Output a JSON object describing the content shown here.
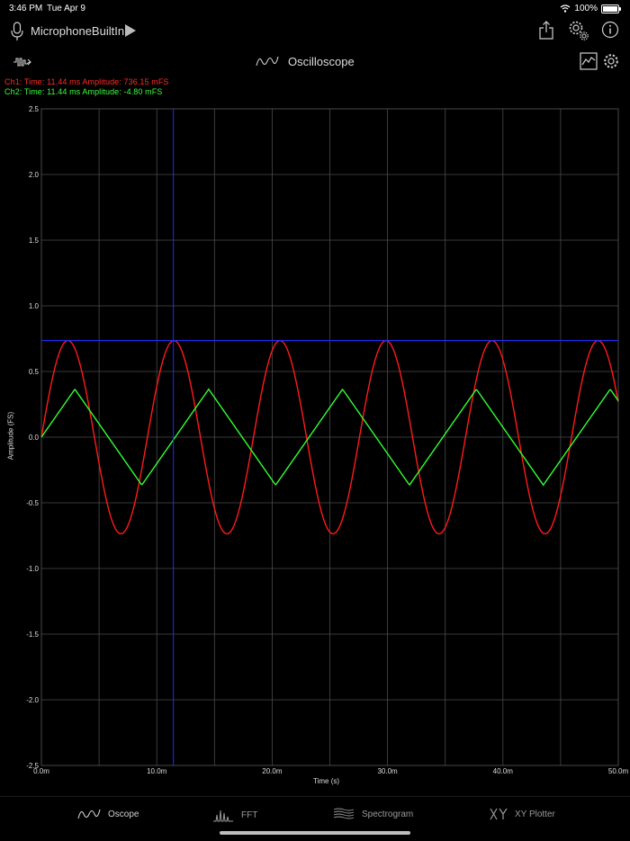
{
  "status_bar": {
    "time": "3:46 PM",
    "date": "Tue Apr 9",
    "battery": "100%",
    "battery_level": 1.0
  },
  "toolbar": {
    "input_source": "MicrophoneBuiltIn"
  },
  "header": {
    "title": "Oscilloscope"
  },
  "readouts": {
    "ch1": "Ch1:  Time: 11.44 ms  Amplitude: 736.15 mFS",
    "ch2": "Ch2:  Time: 11.44 ms  Amplitude: -4.80 mFS"
  },
  "colors": {
    "ch1": "#ff1a1a",
    "ch2": "#33ff33",
    "cursor": "#1f2cff",
    "grid": "#4a4a4a"
  },
  "chart_data": {
    "type": "line",
    "xlabel": "Time (s)",
    "ylabel": "Amplitude (FS)",
    "xlim": [
      0,
      50
    ],
    "ylim": [
      -2.5,
      2.5
    ],
    "x_ticks": [
      0,
      10,
      20,
      30,
      40,
      50
    ],
    "x_tick_labels": [
      "0.0m",
      "10.0m",
      "20.0m",
      "30.0m",
      "40.0m",
      "50.0m"
    ],
    "y_ticks": [
      2.5,
      2.0,
      1.5,
      1.0,
      0.5,
      0.0,
      -0.5,
      -1.0,
      -1.5,
      -2.0,
      -2.5
    ],
    "y_tick_labels": [
      "2.5",
      "2.0",
      "1.5",
      "1.0",
      "0.5",
      "0.0",
      "-0.5",
      "-1.0",
      "-1.5",
      "-2.0",
      "-2.5"
    ],
    "grid": true,
    "series": [
      {
        "name": "Ch1",
        "shape": "sine",
        "amplitude": 0.736,
        "period_ms": 9.19,
        "phase_ms": 0.0,
        "color": "#ff1a1a"
      },
      {
        "name": "Ch2",
        "shape": "triangle",
        "amplitude": 0.365,
        "period_ms": 11.6,
        "phase_ms": 0.0,
        "color": "#33ff33"
      }
    ],
    "cursor": {
      "time_ms": 11.44,
      "amplitude": 0.736
    }
  },
  "tabs": [
    {
      "label": "Oscope",
      "icon": "wave-icon",
      "active": true
    },
    {
      "label": "FFT",
      "icon": "fft-icon",
      "active": false
    },
    {
      "label": "Spectrogram",
      "icon": "spectrogram-icon",
      "active": false
    },
    {
      "label": "XY Plotter",
      "icon": "xy-icon",
      "active": false
    }
  ]
}
